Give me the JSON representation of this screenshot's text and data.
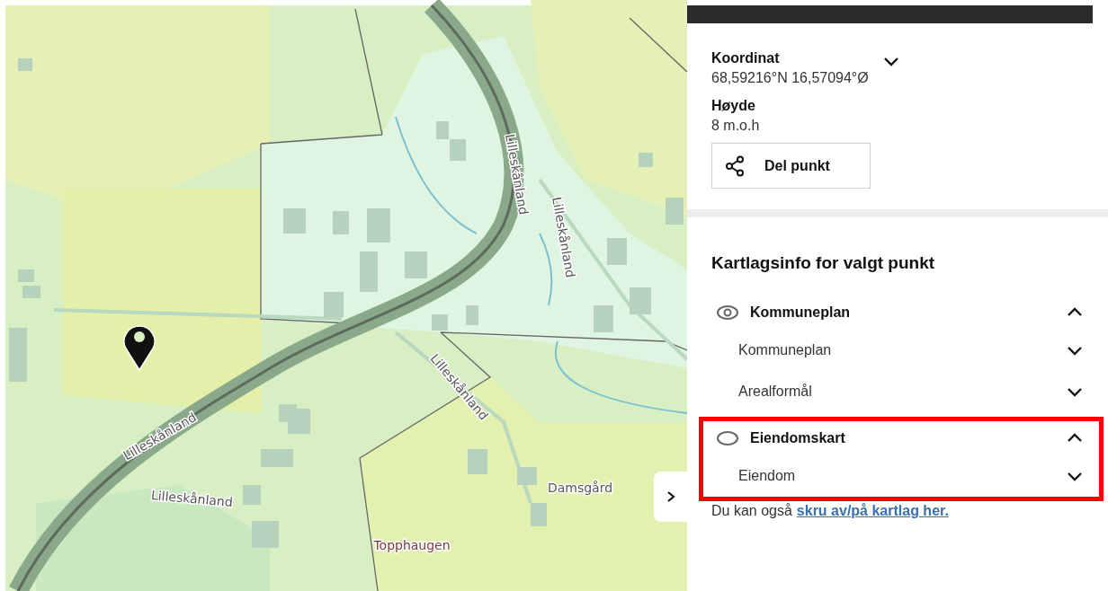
{
  "map": {
    "labels": [
      {
        "text": "Lilleskånland",
        "kind": "road"
      },
      {
        "text": "Lilleskånland",
        "kind": "road"
      },
      {
        "text": "Lilleskånland",
        "kind": "road"
      },
      {
        "text": "Lilleskånland",
        "kind": "road"
      },
      {
        "text": "Lilleskånland",
        "kind": "road"
      },
      {
        "text": "Damsgård",
        "kind": "place"
      },
      {
        "text": "Topphaugen",
        "kind": "hill"
      }
    ]
  },
  "panel": {
    "coordinate": {
      "label": "Koordinat",
      "value": "68,59216°N 16,57094°Ø",
      "expanded": false
    },
    "height": {
      "label": "Høyde",
      "value": "8 m.o.h"
    },
    "share_button": "Del punkt",
    "section_title": "Kartlagsinfo for valgt punkt",
    "layers": [
      {
        "name": "Kommuneplan",
        "visible": true,
        "expanded": true,
        "highlighted": false,
        "children": [
          {
            "name": "Kommuneplan",
            "expanded": false
          },
          {
            "name": "Arealformål",
            "expanded": false
          }
        ]
      },
      {
        "name": "Eiendomskart",
        "visible": false,
        "expanded": true,
        "highlighted": true,
        "children": [
          {
            "name": "Eiendom",
            "expanded": false
          }
        ]
      }
    ],
    "footer": {
      "text": "Du kan også",
      "link": "skru av/på kartlag her."
    }
  }
}
